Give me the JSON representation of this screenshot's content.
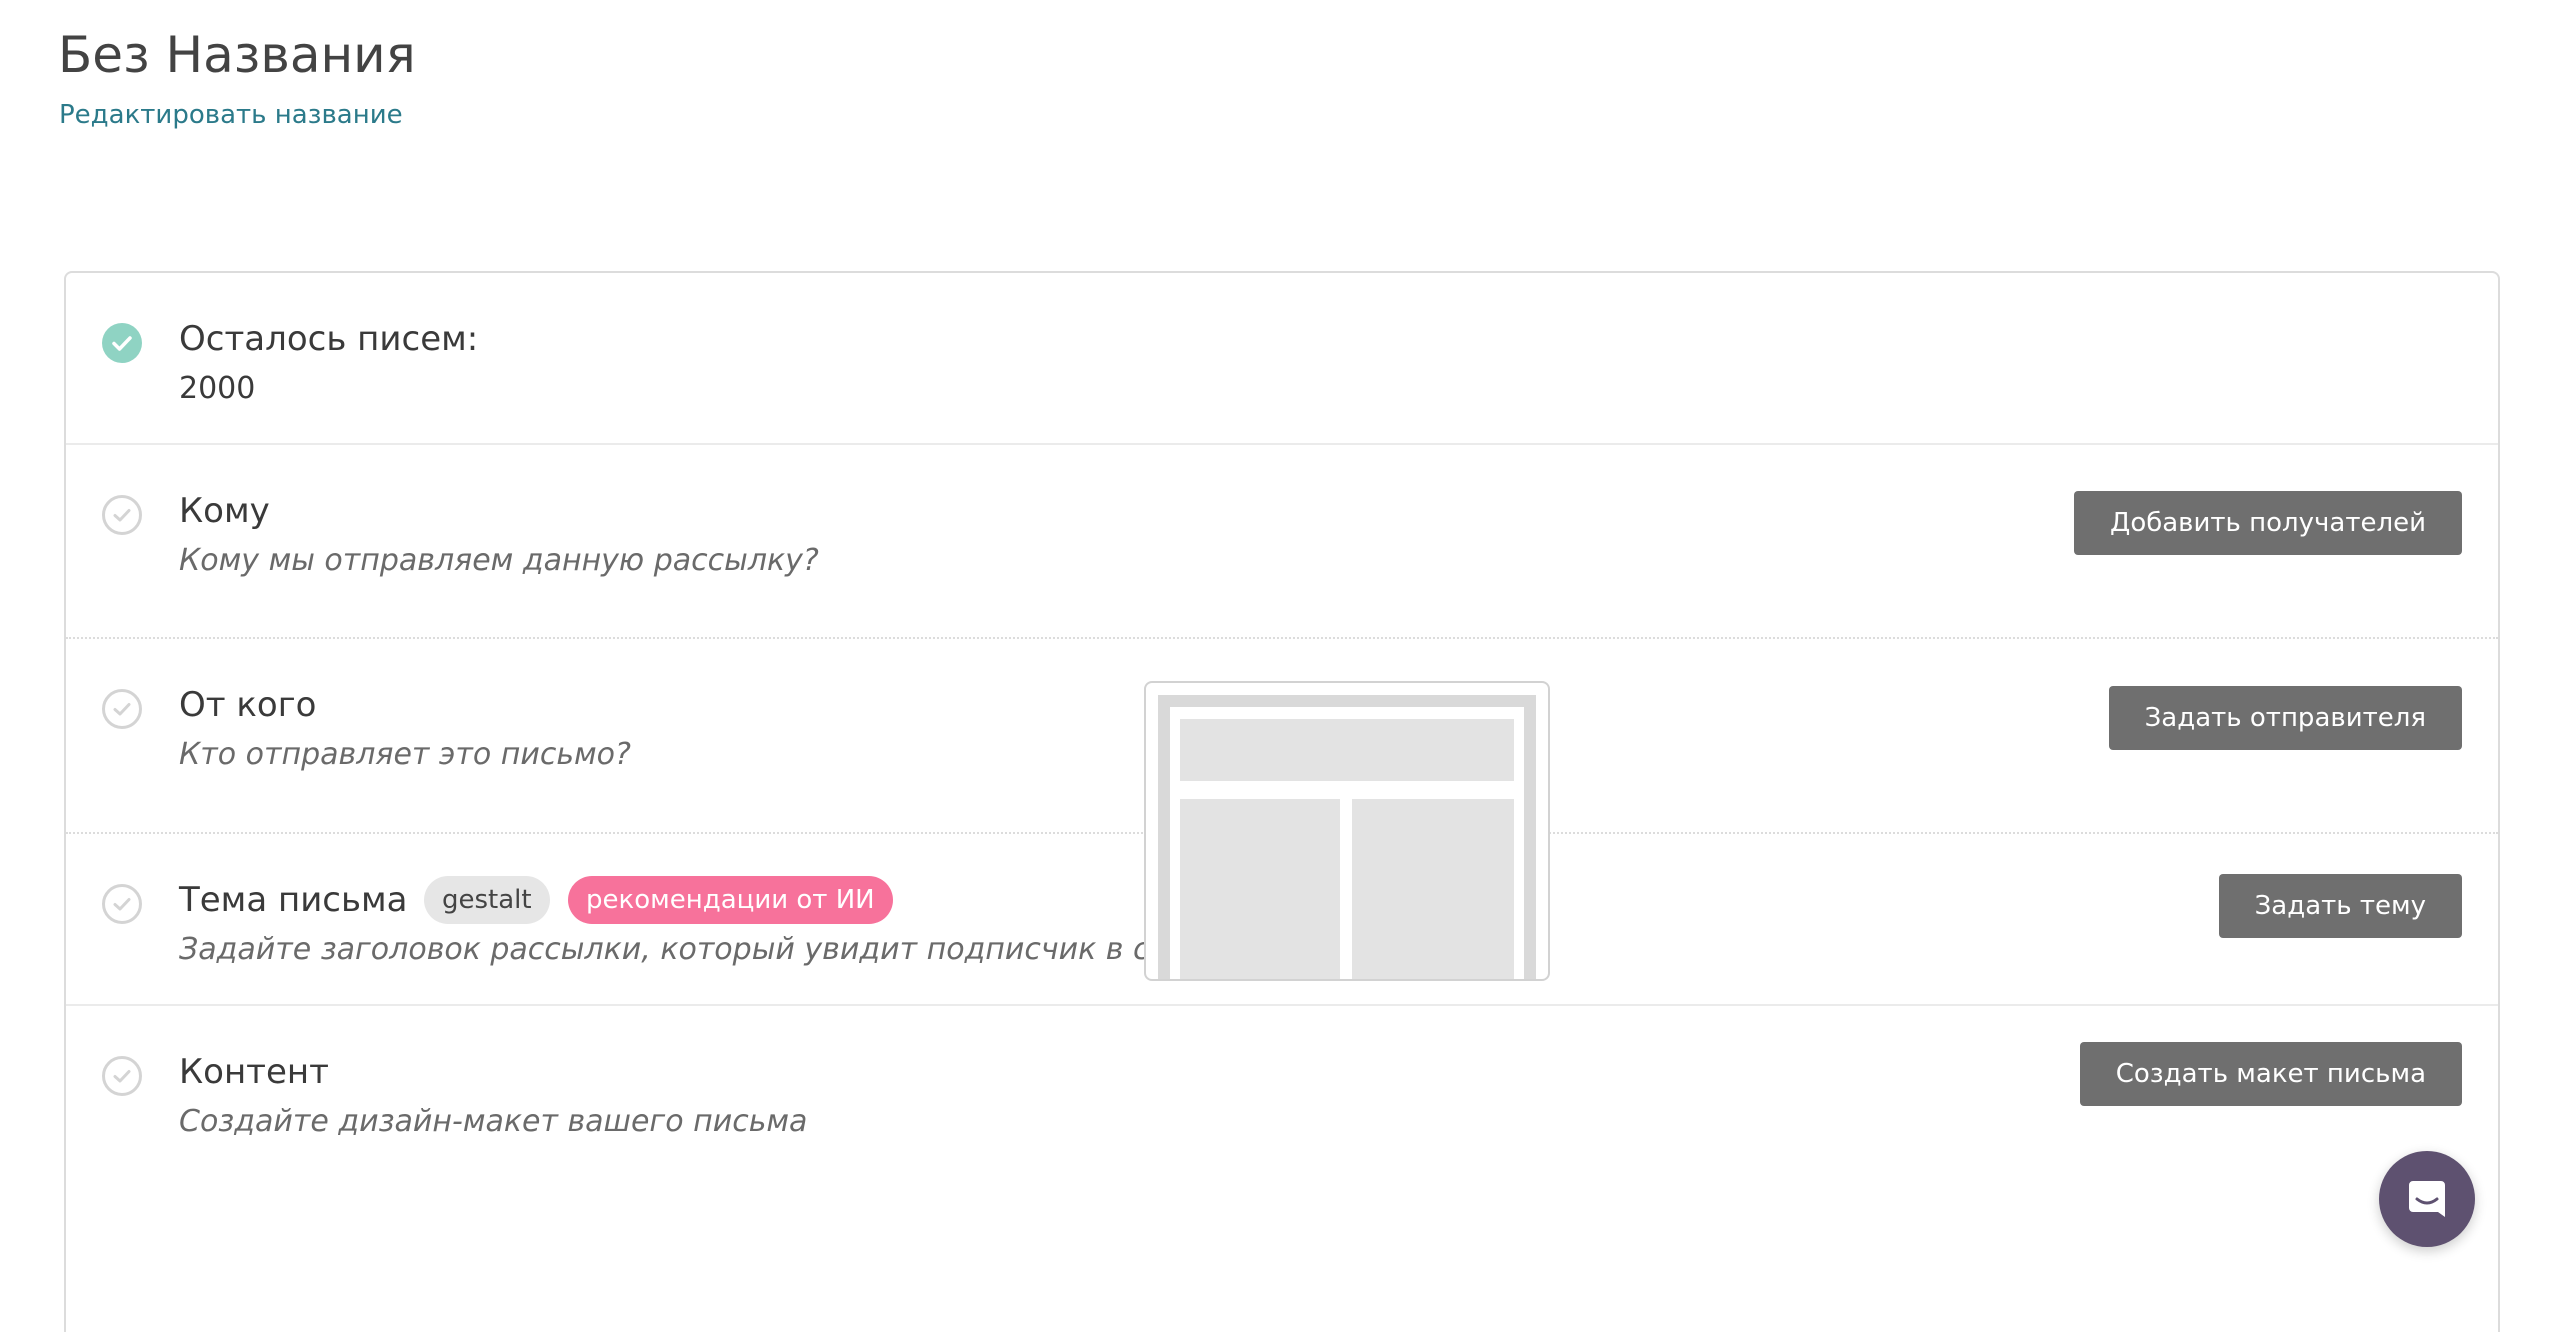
{
  "header": {
    "title": "Без Названия",
    "edit_link": "Редактировать название"
  },
  "steps": {
    "remaining": {
      "title": "Осталось писем:",
      "value": "2000",
      "status": "done"
    },
    "to": {
      "title": "Кому",
      "subtitle": "Кому мы отправляем данную рассылку?",
      "button": "Добавить получателей",
      "status": "todo"
    },
    "from": {
      "title": "От кого",
      "subtitle": "Кто отправляет это письмо?",
      "button": "Задать отправителя",
      "status": "todo"
    },
    "subject": {
      "title": "Тема письма",
      "tag_gray": "gestalt",
      "tag_pink": "рекомендации от ИИ",
      "subtitle": "Задайте заголовок рассылки, который увидит подписчик в своем почтовом клиенте.",
      "button": "Задать тему",
      "status": "todo"
    },
    "content": {
      "title": "Контент",
      "subtitle": "Создайте дизайн-макет вашего письма",
      "button": "Создать макет письма",
      "status": "todo"
    }
  },
  "icons": {
    "check": "check-circle-icon",
    "chat": "chat-bubble-icon"
  },
  "colors": {
    "accent_teal": "#8fd3c3",
    "link": "#2b7a8a",
    "button_bg": "#6f6f6f",
    "tag_pink": "#f7729b",
    "chat_bg": "#5e5170"
  }
}
